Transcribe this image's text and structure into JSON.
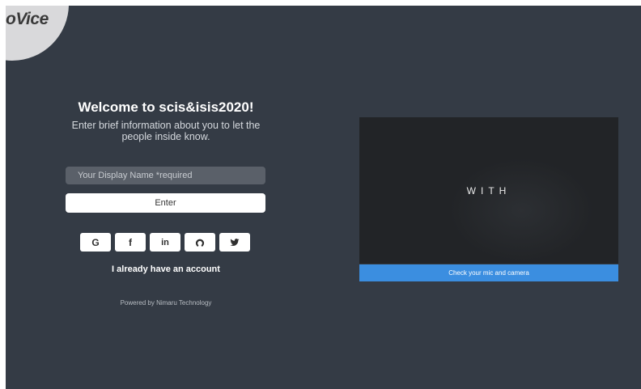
{
  "brand": {
    "logo": "oVice"
  },
  "welcome": {
    "title": "Welcome to scis&isis2020!",
    "subtitle": "Enter brief information about you to let the people inside know."
  },
  "form": {
    "name_placeholder": "Your Display Name *required",
    "enter_label": "Enter"
  },
  "social": [
    {
      "label": "G",
      "icon": "google-icon"
    },
    {
      "label": "f",
      "icon": "facebook-icon"
    },
    {
      "label": "in",
      "icon": "linkedin-icon"
    },
    {
      "label": "github",
      "icon": "github-icon"
    },
    {
      "label": "twitter",
      "icon": "twitter-icon"
    }
  ],
  "account_link": "I already have an account",
  "powered_by": "Powered by Nimaru Technology",
  "preview": {
    "overlay_text": "WITH",
    "check_label": "Check your mic and camera"
  }
}
